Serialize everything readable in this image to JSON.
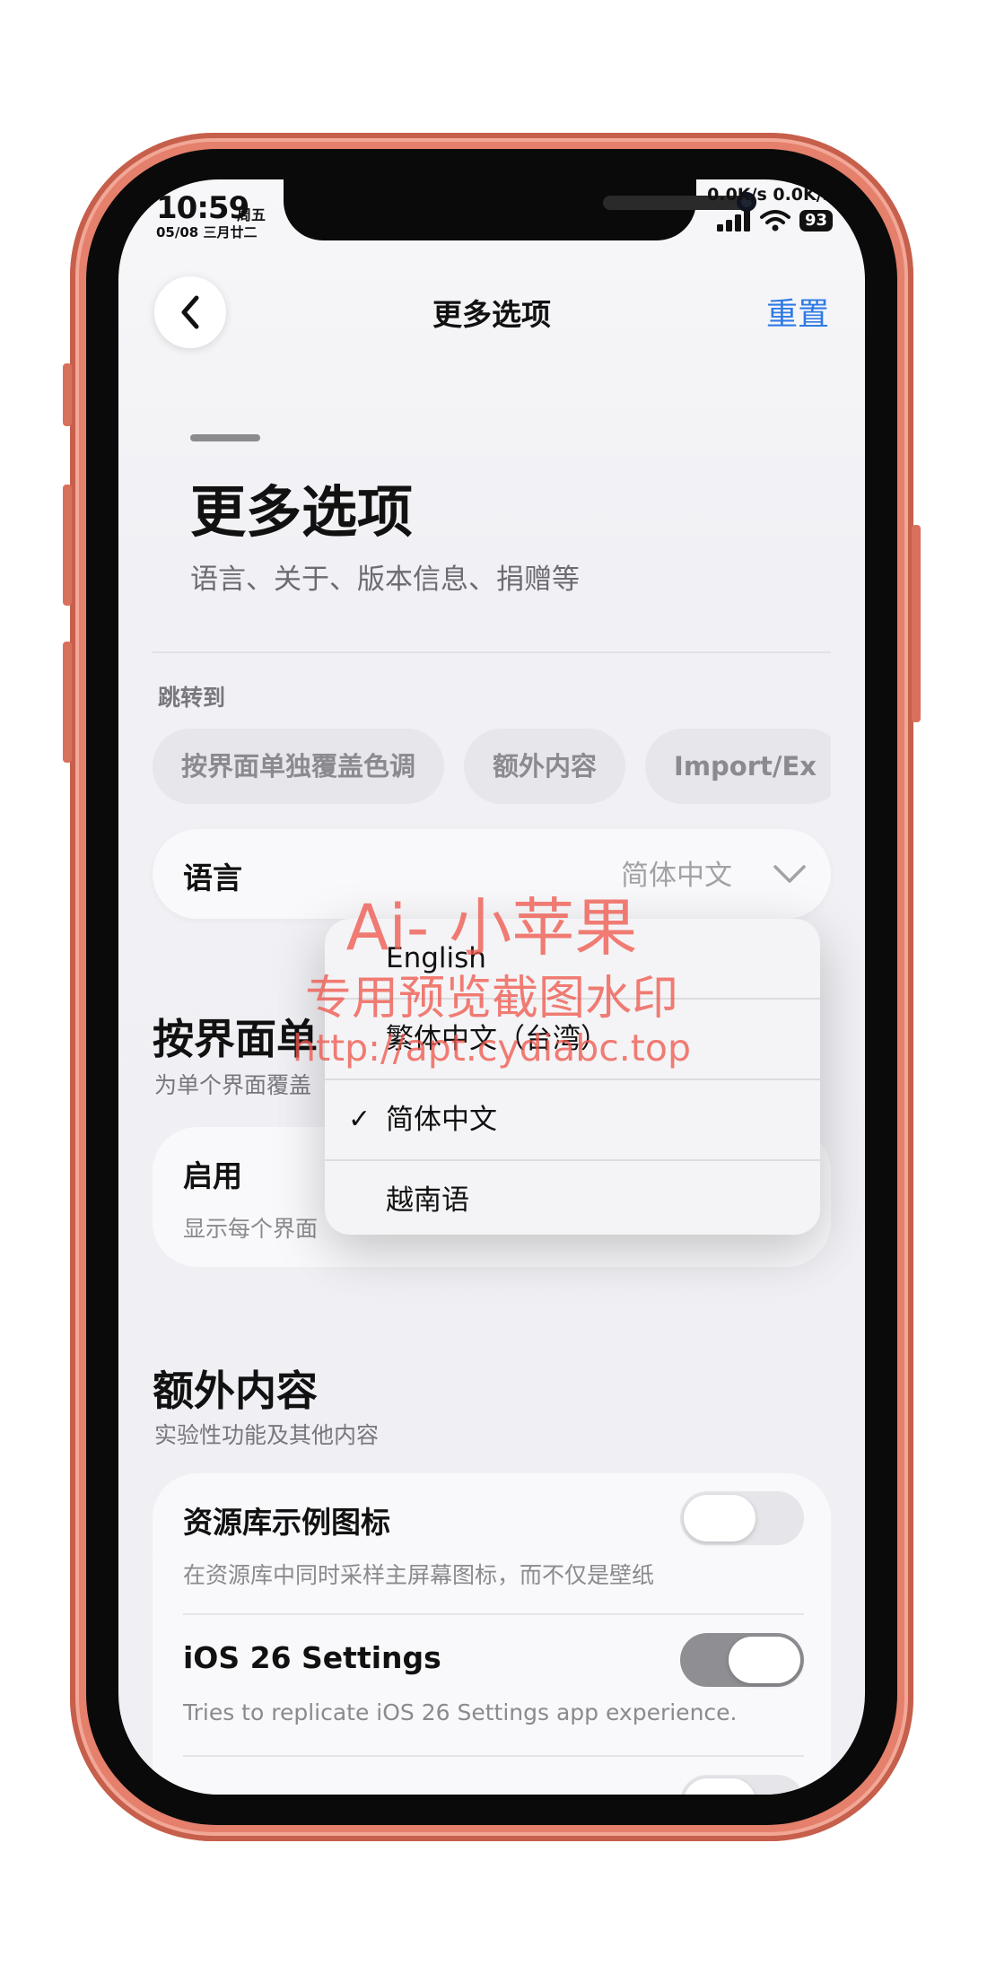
{
  "status_bar": {
    "time": "10:59",
    "weekday": "周五",
    "date": "05/08 三月廿二",
    "net_speed": "0.0K/s 0.0K/s",
    "battery": "93"
  },
  "nav": {
    "title": "更多选项",
    "reset_label": "重置"
  },
  "header": {
    "title": "更多选项",
    "subtitle": "语言、关于、版本信息、捐赠等"
  },
  "jump": {
    "label": "跳转到",
    "chips": [
      "按界面单独覆盖色调",
      "额外内容",
      "Import/Ex"
    ]
  },
  "language": {
    "label": "语言",
    "value": "简体中文"
  },
  "dropdown": {
    "options": [
      "English",
      "繁体中文（台湾）",
      "简体中文",
      "越南语"
    ],
    "selected_index": 2
  },
  "section_override": {
    "title": "按界面单",
    "subtitle": "为单个界面覆盖",
    "row_title": "启用",
    "row_desc": "显示每个界面"
  },
  "section_extra": {
    "title": "额外内容",
    "subtitle": "实验性功能及其他内容",
    "rows": [
      {
        "title": "资源库示例图标",
        "desc": "在资源库中同时采样主屏幕图标，而不仅是壁纸",
        "on": false
      },
      {
        "title": "iOS 26 Settings",
        "desc": "Tries to replicate iOS 26 Settings app experience.",
        "on": true
      }
    ]
  },
  "watermark": {
    "line1": "Ai- 小苹果",
    "line2": "专用预览截图水印",
    "line3": "http://apt.cydiabc.top"
  },
  "colors": {
    "accent": "#2f7ae5",
    "frame": "#e4806b",
    "watermark": "#ee584e"
  }
}
